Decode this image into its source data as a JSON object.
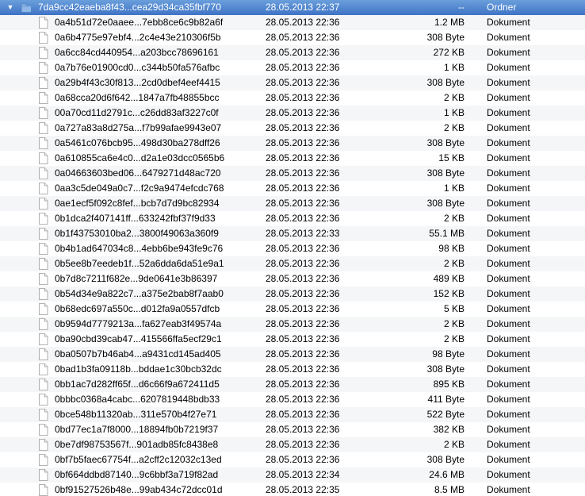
{
  "folder": {
    "name": "7da9cc42eaeba8f43...cea29d34ca35fbf770",
    "date": "28.05.2013 22:37",
    "size": "--",
    "kind": "Ordner",
    "expanded": true,
    "icon": "folder-icon"
  },
  "files": [
    {
      "name": "0a4b51d72e0aaee...7ebb8ce6c9b82a6f",
      "date": "28.05.2013 22:36",
      "size": "1.2 MB",
      "kind": "Dokument"
    },
    {
      "name": "0a6b4775e97ebf4...2c4e43e210306f5b",
      "date": "28.05.2013 22:36",
      "size": "308 Byte",
      "kind": "Dokument"
    },
    {
      "name": "0a6cc84cd440954...a203bcc78696161",
      "date": "28.05.2013 22:36",
      "size": "272 KB",
      "kind": "Dokument"
    },
    {
      "name": "0a7b76e01900cd0...c344b50fa576afbc",
      "date": "28.05.2013 22:36",
      "size": "1 KB",
      "kind": "Dokument"
    },
    {
      "name": "0a29b4f43c30f813...2cd0dbef4eef4415",
      "date": "28.05.2013 22:36",
      "size": "308 Byte",
      "kind": "Dokument"
    },
    {
      "name": "0a68cca20d6f642...1847a7fb48855bcc",
      "date": "28.05.2013 22:36",
      "size": "2 KB",
      "kind": "Dokument"
    },
    {
      "name": "00a70cd11d2791c...c26dd83af3227c0f",
      "date": "28.05.2013 22:36",
      "size": "1 KB",
      "kind": "Dokument"
    },
    {
      "name": "0a727a83a8d275a...f7b99afae9943e07",
      "date": "28.05.2013 22:36",
      "size": "2 KB",
      "kind": "Dokument"
    },
    {
      "name": "0a5461c076bcb95...498d30ba278dff26",
      "date": "28.05.2013 22:36",
      "size": "308 Byte",
      "kind": "Dokument"
    },
    {
      "name": "0a610855ca6e4c0...d2a1e03dcc0565b6",
      "date": "28.05.2013 22:36",
      "size": "15 KB",
      "kind": "Dokument"
    },
    {
      "name": "0a04663603bed06...6479271d48ac720",
      "date": "28.05.2013 22:36",
      "size": "308 Byte",
      "kind": "Dokument"
    },
    {
      "name": "0aa3c5de049a0c7...f2c9a9474efcdc768",
      "date": "28.05.2013 22:36",
      "size": "1 KB",
      "kind": "Dokument"
    },
    {
      "name": "0ae1ecf5f092c8fef...bcb7d7d9bc82934",
      "date": "28.05.2013 22:36",
      "size": "308 Byte",
      "kind": "Dokument"
    },
    {
      "name": "0b1dca2f407141ff...633242fbf37f9d33",
      "date": "28.05.2013 22:36",
      "size": "2 KB",
      "kind": "Dokument"
    },
    {
      "name": "0b1f43753010ba2...3800f49063a360f9",
      "date": "28.05.2013 22:33",
      "size": "55.1 MB",
      "kind": "Dokument"
    },
    {
      "name": "0b4b1ad647034c8...4ebb6be943fe9c76",
      "date": "28.05.2013 22:36",
      "size": "98 KB",
      "kind": "Dokument"
    },
    {
      "name": "0b5ee8b7eedeb1f...52a6dda6da51e9a1",
      "date": "28.05.2013 22:36",
      "size": "2 KB",
      "kind": "Dokument"
    },
    {
      "name": "0b7d8c7211f682e...9de0641e3b86397",
      "date": "28.05.2013 22:36",
      "size": "489 KB",
      "kind": "Dokument"
    },
    {
      "name": "0b54d34e9a822c7...a375e2bab8f7aab0",
      "date": "28.05.2013 22:36",
      "size": "152 KB",
      "kind": "Dokument"
    },
    {
      "name": "0b68edc697a550c...d012fa9a0557dfcb",
      "date": "28.05.2013 22:36",
      "size": "5 KB",
      "kind": "Dokument"
    },
    {
      "name": "0b9594d7779213a...fa627eab3f49574a",
      "date": "28.05.2013 22:36",
      "size": "2 KB",
      "kind": "Dokument"
    },
    {
      "name": "0ba90cbd39cab47...415566ffa5ecf29c1",
      "date": "28.05.2013 22:36",
      "size": "2 KB",
      "kind": "Dokument"
    },
    {
      "name": "0ba0507b7b46ab4...a9431cd145ad405",
      "date": "28.05.2013 22:36",
      "size": "98 Byte",
      "kind": "Dokument"
    },
    {
      "name": "0bad1b3fa09118b...bddae1c30bcb32dc",
      "date": "28.05.2013 22:36",
      "size": "308 Byte",
      "kind": "Dokument"
    },
    {
      "name": "0bb1ac7d282ff65f...d6c66f9a672411d5",
      "date": "28.05.2013 22:36",
      "size": "895 KB",
      "kind": "Dokument"
    },
    {
      "name": "0bbbc0368a4cabc...6207819448bdb33",
      "date": "28.05.2013 22:36",
      "size": "411 Byte",
      "kind": "Dokument"
    },
    {
      "name": "0bce548b11320ab...311e570b4f27e71",
      "date": "28.05.2013 22:36",
      "size": "522 Byte",
      "kind": "Dokument"
    },
    {
      "name": "0bd77ec1a7f8000...18894fb0b7219f37",
      "date": "28.05.2013 22:36",
      "size": "382 KB",
      "kind": "Dokument"
    },
    {
      "name": "0be7df98753567f...901adb85fc8438e8",
      "date": "28.05.2013 22:36",
      "size": "2 KB",
      "kind": "Dokument"
    },
    {
      "name": "0bf7b5faec67754f...a2cff2c12032c13ed",
      "date": "28.05.2013 22:36",
      "size": "308 Byte",
      "kind": "Dokument"
    },
    {
      "name": "0bf664ddbd87140...9c6bbf3a719f82ad",
      "date": "28.05.2013 22:34",
      "size": "24.6 MB",
      "kind": "Dokument"
    },
    {
      "name": "0bf91527526b48e...99ab434c72dcc01d",
      "date": "28.05.2013 22:35",
      "size": "8.5 MB",
      "kind": "Dokument"
    }
  ],
  "icons": {
    "disclosure": "disclosure-triangle-icon",
    "document": "document-icon",
    "folder": "folder-icon"
  },
  "colors": {
    "selection_top": "#6a9fdc",
    "selection_bottom": "#3f73c5",
    "stripe": "#f5f6f8",
    "folder_blue": "#8fb8e8"
  }
}
